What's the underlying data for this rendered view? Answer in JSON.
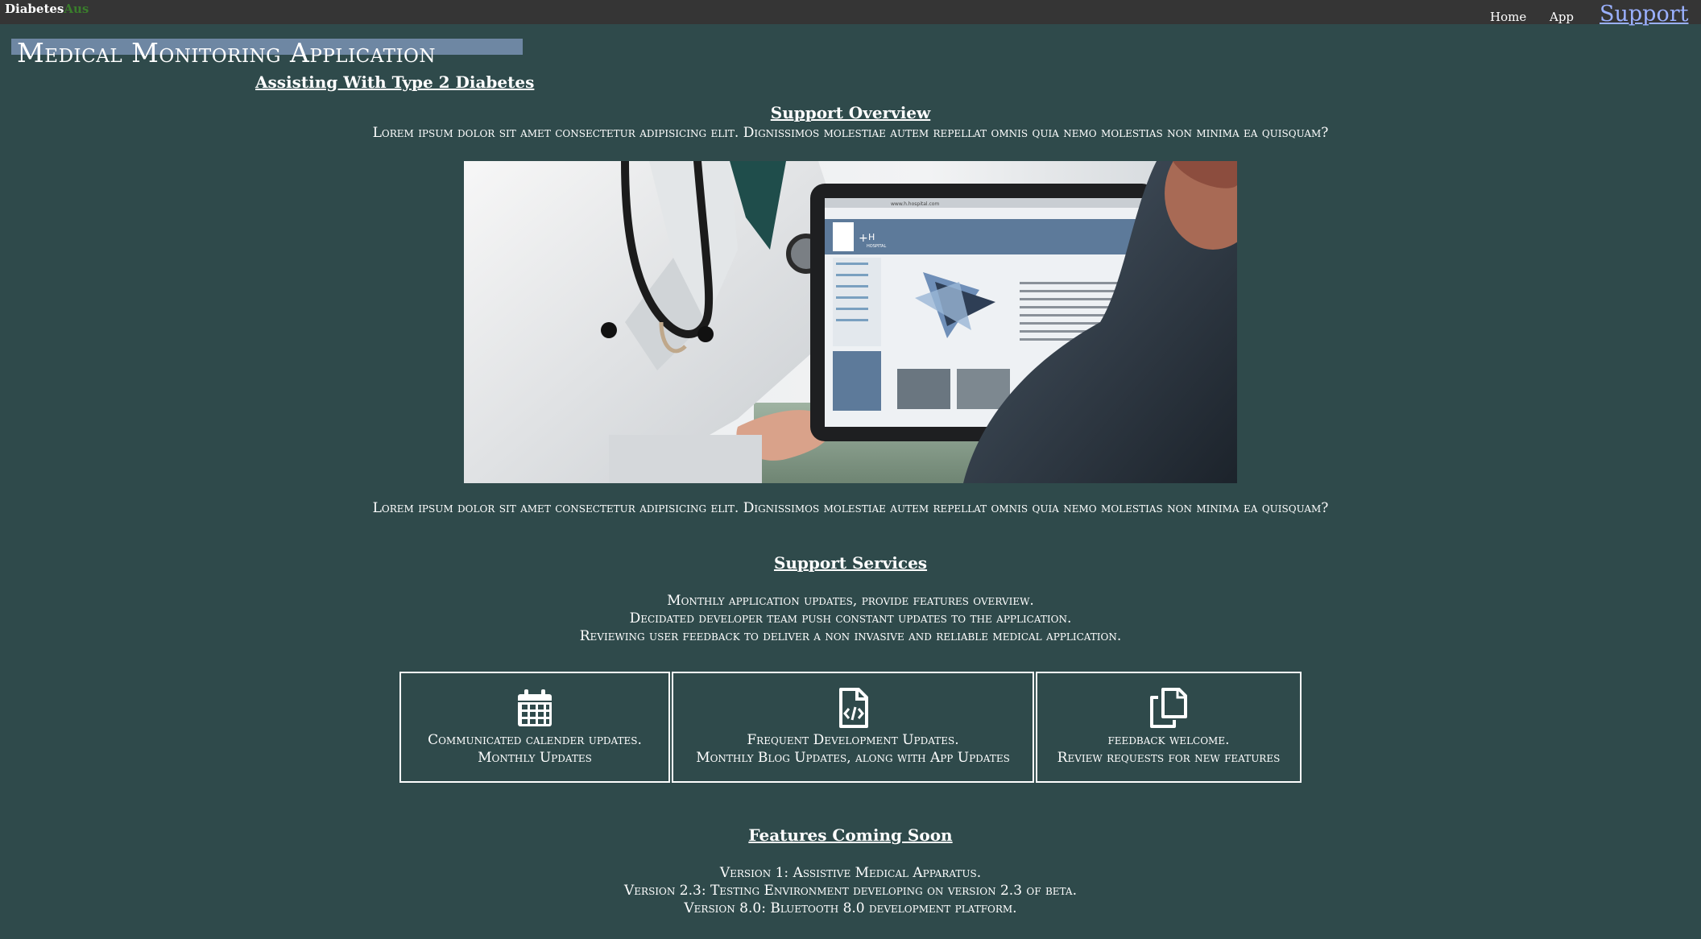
{
  "brand": {
    "part1": "Diabetes",
    "part2": "Aus"
  },
  "nav": {
    "home": "Home",
    "app": "App",
    "support": "Support"
  },
  "header": {
    "title": "Medical Monitoring Application",
    "subtitle": "Assisting With Type 2 Diabetes"
  },
  "overview": {
    "heading": "Support Overview",
    "text_top": "Lorem ipsum dolor sit amet consectetur adipisicing elit. Dignissimos molestiae autem repellat omnis quia nemo molestias non minima ea quisquam?",
    "text_bottom": "Lorem ipsum dolor sit amet consectetur adipisicing elit. Dignissimos molestiae autem repellat omnis quia nemo molestias non minima ea quisquam?",
    "image_screen": {
      "url": "www.h.hospital.com",
      "logo": "H",
      "logo_sub": "HOSPITAL"
    }
  },
  "services": {
    "heading": "Support Services",
    "lines": [
      "Monthly application updates, provide features overview.",
      "Decidated developer team push constant updates to the application.",
      "Reviewing user feedback to deliver a non invasive and reliable medical application."
    ],
    "boxes": [
      {
        "icon": "calendar-icon",
        "line1": "Communicated calender updates.",
        "line2": "Monthly Updates"
      },
      {
        "icon": "code-file-icon",
        "line1": "Frequent Development Updates.",
        "line2": "Monthly Blog Updates, along with App Updates"
      },
      {
        "icon": "copy-files-icon",
        "line1": "feedback welcome.",
        "line2": "Review requests for new features"
      }
    ]
  },
  "features": {
    "heading": "Features Coming Soon",
    "lines": [
      "Version 1: Assistive Medical Apparatus.",
      "Version 2.3: Testing Environment developing on version 2.3 of beta.",
      "Version 8.0: Bluetooth 8.0 development platform."
    ]
  },
  "colors": {
    "page_bg": "#2f4a4b",
    "topbar_bg": "#353535",
    "brand_accent": "#3a7d2c",
    "support_link": "#9ab0ff",
    "title_band": "#6e87a3"
  }
}
